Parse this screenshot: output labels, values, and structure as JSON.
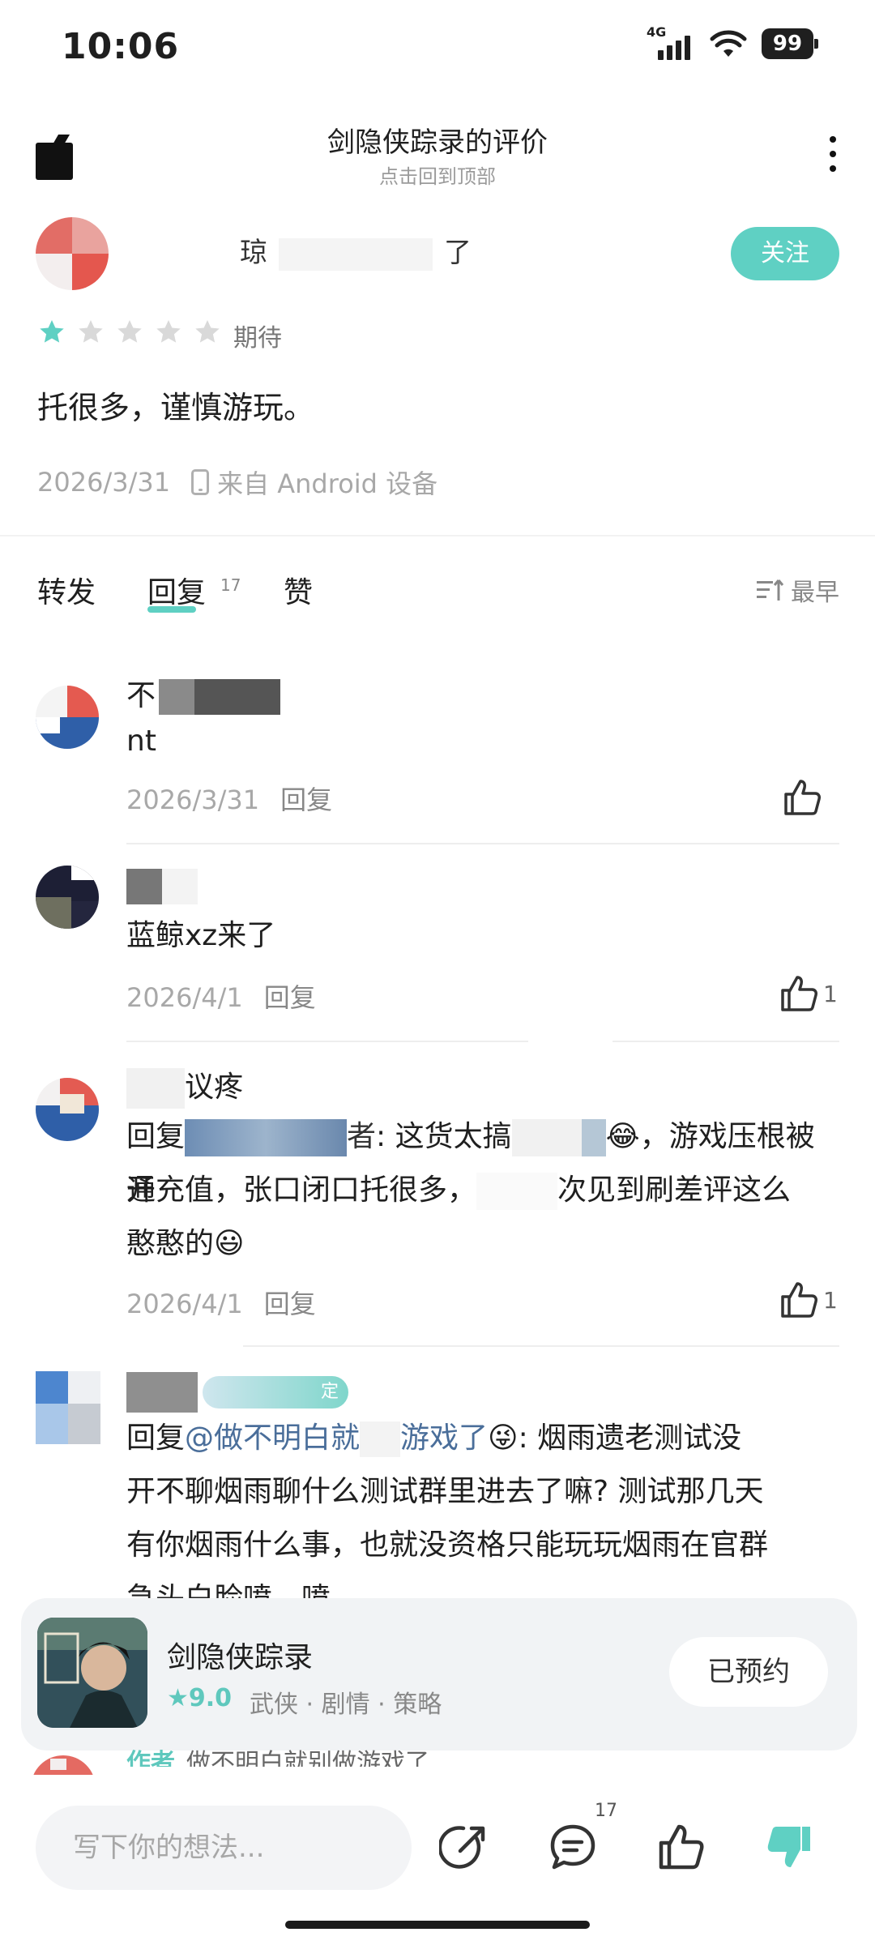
{
  "status": {
    "time": "10:06",
    "network": "4G",
    "battery": "99"
  },
  "header": {
    "title": "剑隐侠踪录的评价",
    "subtitle": "点击回到顶部"
  },
  "review": {
    "author_name_prefix": "琼",
    "author_name_suffix": "了",
    "follow_label": "关注",
    "rating": 1,
    "rating_max": 5,
    "rating_label": "期待",
    "body": "托很多，谨慎游玩。",
    "date": "2026/3/31",
    "device": "来自 Android 设备"
  },
  "tabs": {
    "repost": "转发",
    "reply": "回复",
    "reply_count": "17",
    "like": "赞",
    "sort_label": "最早"
  },
  "comments": [
    {
      "name": "不",
      "text": "nt",
      "date": "2026/3/31",
      "reply_label": "回复",
      "likes": ""
    },
    {
      "name": "",
      "text": "蓝鲸xz来了",
      "date": "2026/4/1",
      "reply_label": "回复",
      "likes": "1"
    },
    {
      "name": "议疼",
      "line1_prefix": "回复",
      "line1_body": ": 这货太搞",
      "line1_tail": "，游戏压根被开",
      "line2_a": "通充值，张口闭口托很多，",
      "line2_b": "次见到刷差评这么",
      "line3": "憨憨的",
      "date": "2026/4/1",
      "reply_label": "回复",
      "likes": "1"
    },
    {
      "badge": "定",
      "line1_prefix": "回复",
      "mention_a": "@做不明白就",
      "mention_b": "游戏了",
      "line1_rest": ": 烟雨遗老测试没",
      "line2": "开不聊烟雨聊什么测试群里进去了嘛? 测试那几天",
      "line3": "有你烟雨什么事，也就没资格只能玩玩烟雨在官群",
      "line4": "急头白脸喷，喷"
    }
  ],
  "game_card": {
    "name": "剑隐侠踪录",
    "rating": "9.0",
    "tags": "武侠 · 剧情 · 策略",
    "button_label": "已预约"
  },
  "peek": {
    "tag": "作者",
    "text": "做不明白就别做游戏了"
  },
  "bottom_bar": {
    "input_placeholder": "写下你的想法...",
    "comment_count": "17"
  },
  "colors": {
    "accent": "#5fd0c3",
    "mention": "#4a6e9a",
    "muted": "#a8a8a8"
  }
}
